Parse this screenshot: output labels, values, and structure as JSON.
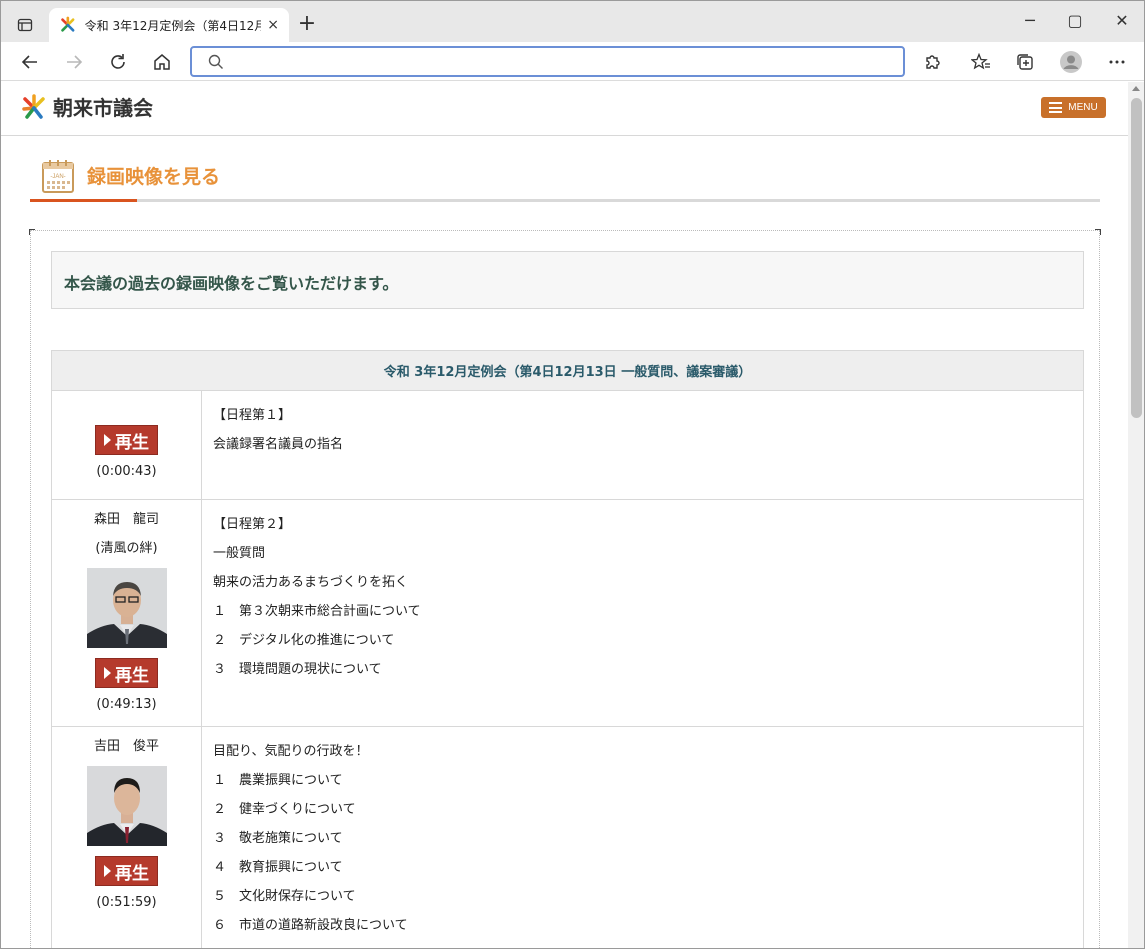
{
  "browser": {
    "tab_title": "令和 3年12月定例会（第4日12月",
    "tab_close": "×",
    "new_tab": "+",
    "address_value": "",
    "address_placeholder": "",
    "window_controls": {
      "minimize": "─",
      "maximize": "▢",
      "close": "✕"
    }
  },
  "site": {
    "logo_text": "朝来市議会",
    "menu_label": "MENU",
    "section_title": "録画映像を見る",
    "calendar_label": "-JAN-",
    "intro": "本会議の過去の録画映像をご覧いただけます。"
  },
  "colors": {
    "accent_orange": "#e8923a",
    "underline_red": "#d9541f",
    "menu_bg": "#c8702a",
    "play_btn": "#b53a2c",
    "heading_teal": "#2a5a6a"
  },
  "session": {
    "header": "令和 3年12月定例会（第4日12月13日 一般質問、議案審議）",
    "rows": [
      {
        "speaker": "",
        "affiliation": "",
        "has_photo": false,
        "play_label": "再生",
        "duration": "(0:00:43)",
        "lines": [
          "【日程第１】",
          "会議録署名議員の指名"
        ]
      },
      {
        "speaker": "森田　龍司",
        "affiliation": "(清風の絆)",
        "has_photo": true,
        "play_label": "再生",
        "duration": "(0:49:13)",
        "lines": [
          "【日程第２】",
          "一般質問",
          "朝来の活力あるまちづくりを拓く",
          "１　第３次朝来市総合計画について",
          "２　デジタル化の推進について",
          "３　環境問題の現状について"
        ]
      },
      {
        "speaker": "吉田　俊平",
        "affiliation": "",
        "has_photo": true,
        "play_label": "再生",
        "duration": "(0:51:59)",
        "lines": [
          "目配り、気配りの行政を！",
          "１　農業振興について",
          "２　健幸づくりについて",
          "３　敬老施策について",
          "４　教育振興について",
          "５　文化財保存について",
          "６　市道の道路新設改良について"
        ]
      }
    ]
  }
}
